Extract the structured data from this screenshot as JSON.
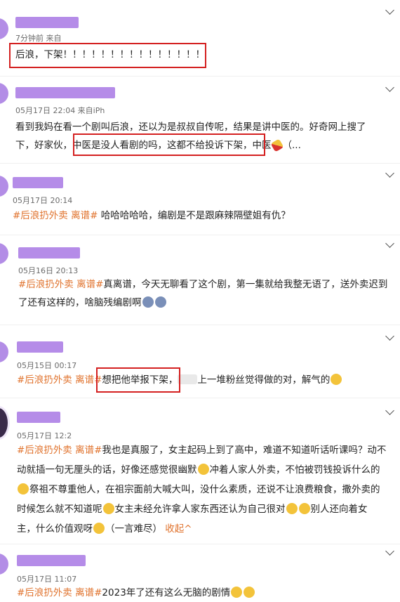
{
  "posts": [
    {
      "meta": "7分钟前  来自",
      "text": "后浪，下架！！！！！！！！！！！！！！！"
    },
    {
      "meta": "05月17日 22:04  来自iPh",
      "line1": "看到我妈在看一个剧叫后浪，还以为是叔叔自传呢，结果是讲中医的。好奇网上搜了",
      "line2_a": "下，好家伙，",
      "line2_b": "中医是没人看剧的吗，这都不给投诉下架，",
      "line2_c": "中医",
      "line2_d": "（..."
    },
    {
      "meta": "05月17日 20:14",
      "tag": "#后浪扔外卖 离谱#",
      "text": " 哈哈哈哈哈，编剧是不是跟麻辣隔壁姐有仇？"
    },
    {
      "meta": "05月16日 20:13",
      "tag": "#后浪扔外卖 离谱#",
      "line1": "真离谱，今天无聊看了这个剧，第一集就给我整无语了，送外卖迟到",
      "line2": "了还有这样的，啥脑残编剧啊"
    },
    {
      "meta": "05月15日 00:17",
      "tag": "#后浪扔外卖 离谱#",
      "text_a": "想把他举报下架，",
      "text_b": "上一堆粉丝觉得做的对，解气的"
    },
    {
      "meta": "05月17日 12:2",
      "tag": "#后浪扔外卖 离谱#",
      "line1": "我也是真服了，女主起码上到了高中，难道不知道听话听课吗？动不",
      "line2_a": "动就插一句无厘头的话，好像还感觉很幽默",
      "line2_b": "冲着人家人外卖，不怕被罚钱投诉什么的",
      "line3_a": "祭祖不尊重他人，在祖宗面前大喊大叫，没什么素质，还说不让浪费粮食，撒外卖的",
      "line4_a": "时候怎么就不知道呢",
      "line4_b": "女主未经允许拿人家东西还认为自己很对",
      "line4_c": "别人还向着女",
      "line5_a": "主，什么价值观呀",
      "line5_b": "（一言难尽）",
      "collapse": "收起^"
    },
    {
      "meta": "05月17日 11:07",
      "tag": "#后浪扔外卖 离谱#",
      "text": "2023年了还有这么无脑的剧情"
    }
  ],
  "colors": {
    "accent": "#e0722c",
    "highlight": "#d42020",
    "name_blur": "#b58ce8"
  }
}
